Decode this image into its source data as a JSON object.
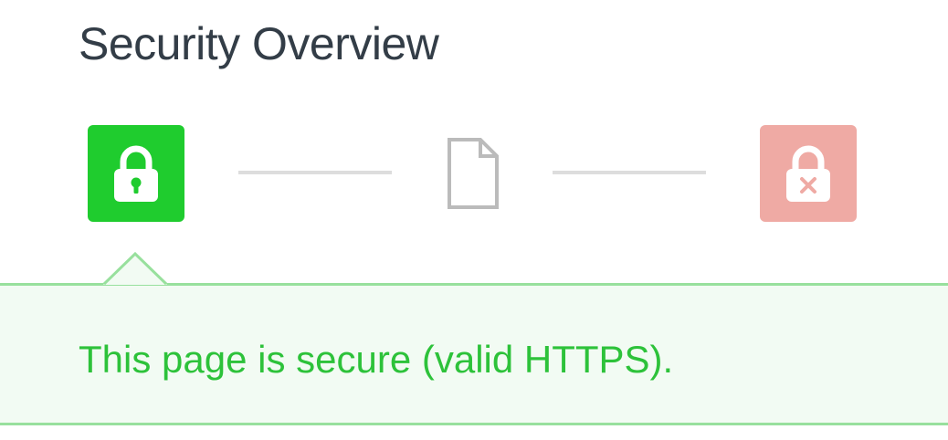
{
  "header": {
    "title": "Security Overview"
  },
  "states": {
    "secure": {
      "icon": "lock-icon",
      "color": "#1fcc2e"
    },
    "document": {
      "icon": "document-icon",
      "color": "#bbbbbb"
    },
    "insecure": {
      "icon": "lock-error-icon",
      "color": "#efaaa4"
    }
  },
  "status_panel": {
    "message": "This page is secure (valid HTTPS).",
    "background": "#f2fbf3",
    "border_color": "#98e09d",
    "text_color": "#2dc23a"
  }
}
